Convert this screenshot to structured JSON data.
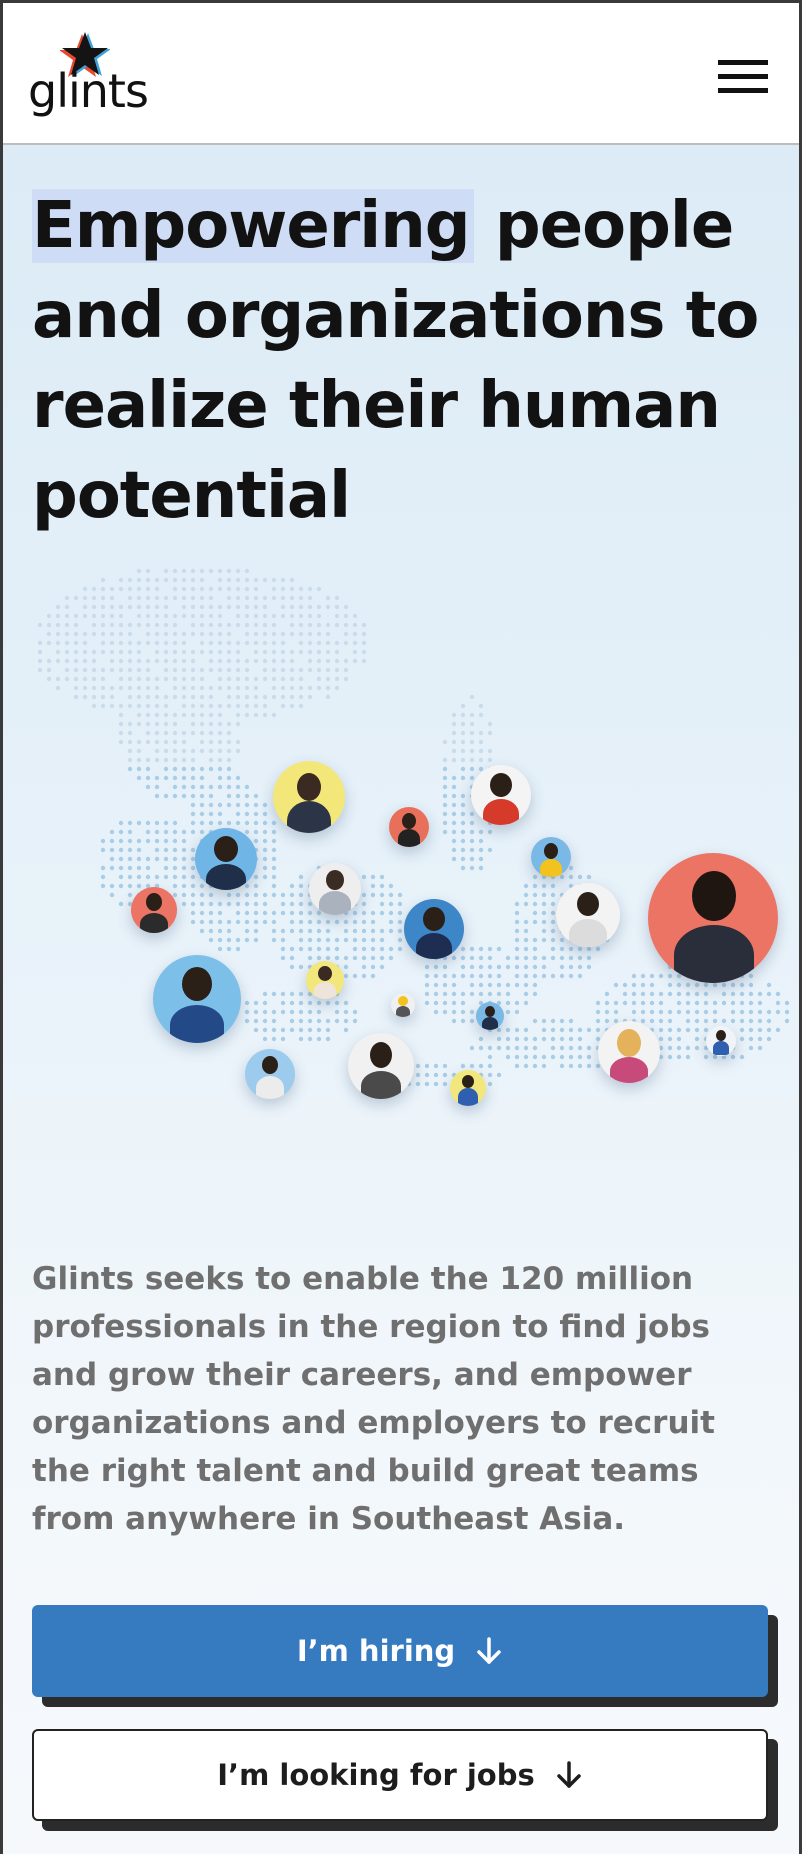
{
  "header": {
    "brand": "glints",
    "menu_icon": "hamburger-menu-icon",
    "logo_icon": "star-icon"
  },
  "hero": {
    "headline_highlight": "Empowering",
    "headline_line1_rest": " people",
    "headline_line2": "and organizations to",
    "headline_line3": "realize their human",
    "headline_line4": "potential",
    "description": "Glints seeks to enable the 120 million professionals in the region to find jobs and grow their careers, and empower organizations and employers to recruit the right talent and build great teams from anywhere in Southeast Asia."
  },
  "actions": {
    "hiring_label": "I’m hiring",
    "jobs_label": "I’m looking for jobs",
    "arrow_icon": "arrow-down-icon"
  },
  "colors": {
    "primary": "#367abf",
    "highlight": "#cfdcf6",
    "text_dark": "#121212",
    "text_muted": "#6f6f6f"
  }
}
